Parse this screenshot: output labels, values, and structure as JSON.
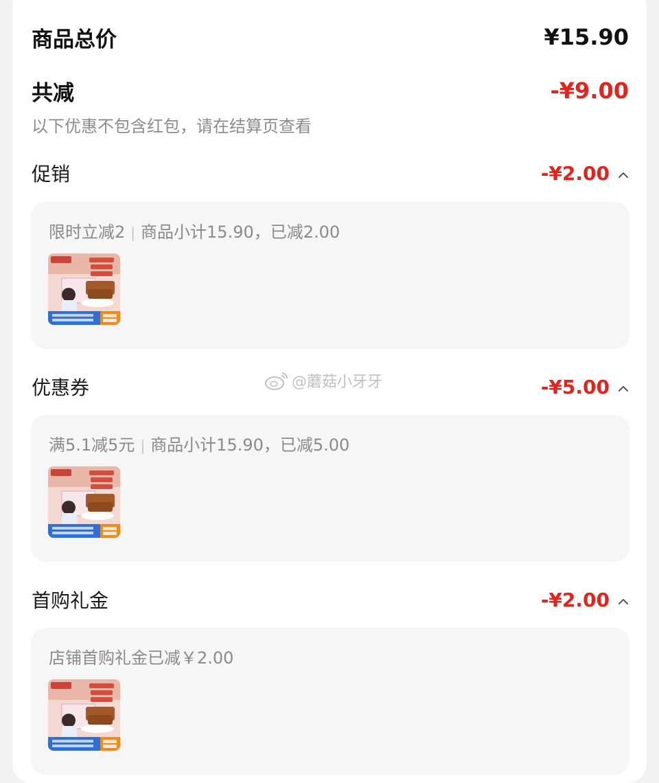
{
  "summary": {
    "total_label": "商品总价",
    "total_value": "¥15.90",
    "reduce_label": "共减",
    "reduce_value": "-¥9.00",
    "note": "以下优惠不包含红包，请在结算页查看"
  },
  "sections": [
    {
      "title": "促销",
      "amount": "-¥2.00",
      "detail_main": "限时立减2",
      "detail_sub": "商品小计15.90，已减2.00"
    },
    {
      "title": "优惠券",
      "amount": "-¥5.00",
      "detail_main": "满5.1减5元",
      "detail_sub": "商品小计15.90，已减5.00"
    },
    {
      "title": "首购礼金",
      "amount": "-¥2.00",
      "detail_main": "店铺首购礼金已减￥2.00",
      "detail_sub": ""
    }
  ],
  "watermark": "@蘑菇小牙牙",
  "icons": {
    "expand": "chevron-up-icon",
    "product": "product-thumbnail",
    "weibo": "weibo-icon"
  },
  "colors": {
    "accent_red": "#e4231c",
    "text_dark": "#111111",
    "text_gray": "#8a8a8a",
    "panel_bg": "#f6f6f6"
  }
}
